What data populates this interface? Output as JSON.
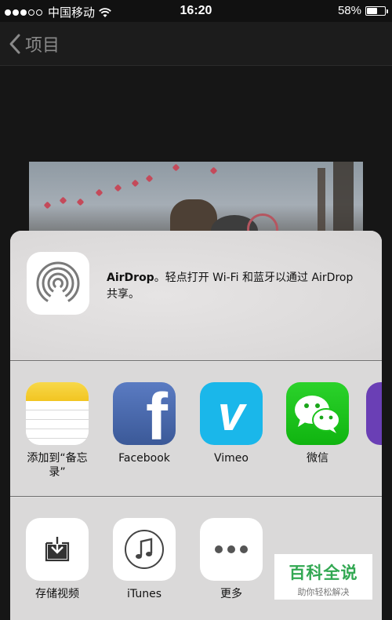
{
  "status_bar": {
    "carrier": "中国移动",
    "time": "16:20",
    "battery": "58%",
    "battery_level": 0.58
  },
  "nav": {
    "back_label": "项目"
  },
  "airdrop": {
    "title": "AirDrop",
    "message": "。轻点打开 Wi-Fi 和蓝牙以通过 AirDrop 共享。"
  },
  "apps": [
    {
      "label": "添加到“备忘录”",
      "icon": "notes-icon"
    },
    {
      "label": "Facebook",
      "icon": "facebook-icon"
    },
    {
      "label": "Vimeo",
      "icon": "vimeo-icon"
    },
    {
      "label": "微信",
      "icon": "wechat-icon"
    }
  ],
  "actions": [
    {
      "label": "存储视频",
      "icon": "save-video-icon"
    },
    {
      "label": "iTunes",
      "icon": "itunes-icon"
    },
    {
      "label": "更多",
      "icon": "more-icon"
    }
  ],
  "colors": {
    "facebook": "#3b5998",
    "vimeo": "#1ab7ea",
    "wechat": "#1bc41b"
  },
  "watermark": {
    "title": "百科全说",
    "subtitle": "助你轻松解决"
  }
}
